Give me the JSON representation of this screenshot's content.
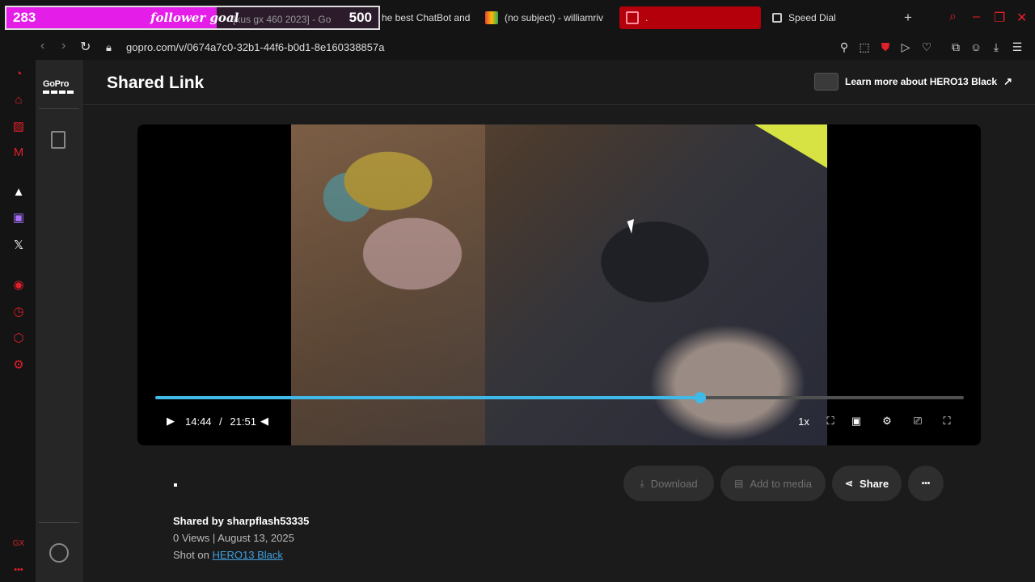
{
  "overlay": {
    "count": "283",
    "label": "follower goal",
    "goal": "500",
    "progress": 0.566
  },
  "tabs": [
    {
      "title": "[xus gx 460 2023] - Go",
      "faded": true
    },
    {
      "title": "he best ChatBot and W"
    },
    {
      "title": "(no subject) - williamriv"
    },
    {
      "title": "."
    },
    {
      "title": "Speed Dial"
    }
  ],
  "address": {
    "url": "gopro.com/v/0674a7c0-32b1-44f6-b0d1-8e160338857a"
  },
  "page": {
    "title": "Shared Link",
    "learn_more": "Learn more about HERO13 Black"
  },
  "player": {
    "current_time": "14:44",
    "separator": "/",
    "duration": "21:51",
    "speed": "1x",
    "progress": 0.674
  },
  "actions": {
    "download": "Download",
    "add_to_media": "Add to media",
    "share": "Share",
    "more": "•••"
  },
  "meta": {
    "shared_by": "Shared by sharpflash53335",
    "views_date": "0 Views | August 13, 2025",
    "shot_on_prefix": "Shot on ",
    "shot_on_camera": "HERO13 Black"
  },
  "colors": {
    "accent": "#3fb9e8",
    "opera_red": "#e0202a",
    "goal_pink": "#e41ee8"
  }
}
